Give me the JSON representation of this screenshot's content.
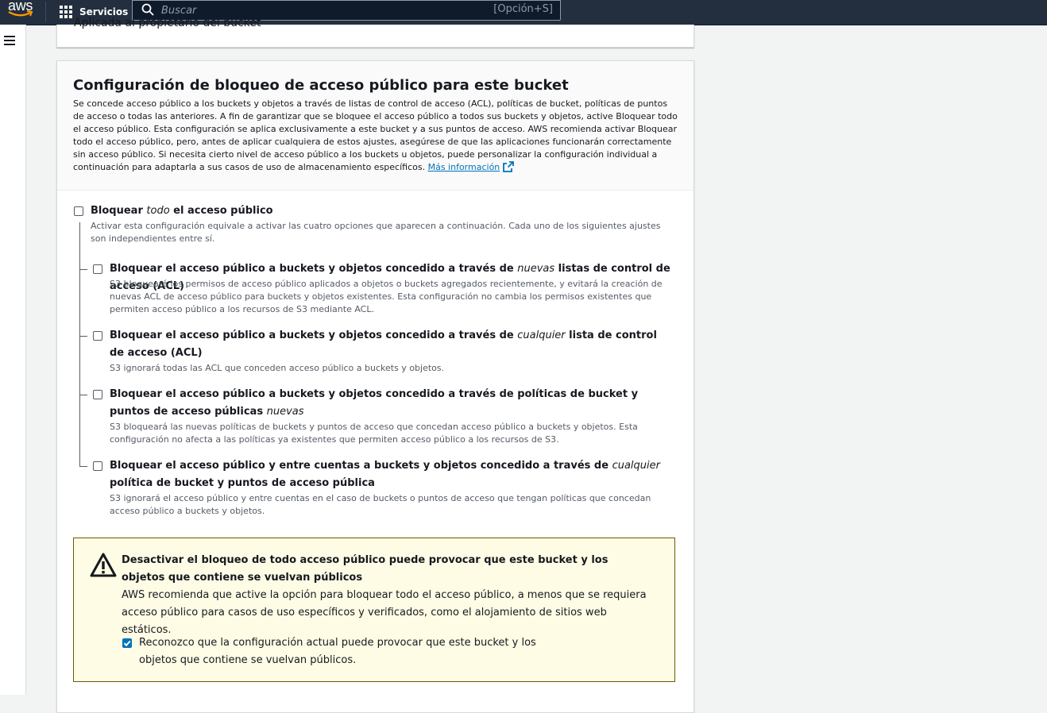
{
  "nav": {
    "logo": "aws",
    "services_label": "Servicios",
    "search_placeholder": "Buscar",
    "search_shortcut": "[Opción+S]"
  },
  "prev_panel": {
    "text": "Aplicada al propietario del bucket"
  },
  "block_public_access": {
    "title": "Configuración de bloqueo de acceso público para este bucket",
    "description": "Se concede acceso público a los buckets y objetos a través de listas de control de acceso (ACL), políticas de bucket, políticas de puntos de acceso o todas las anteriores. A fin de garantizar que se bloquee el acceso público a todos sus buckets y objetos, active Bloquear todo el acceso público. Esta configuración se aplica exclusivamente a este bucket y a sus puntos de acceso. AWS recomienda activar Bloquear todo el acceso público, pero, antes de aplicar cualquiera de estos ajustes, asegúrese de que las aplicaciones funcionarán correctamente sin acceso público. Si necesita cierto nivel de acceso público a los buckets u objetos, puede personalizar la configuración individual a continuación para adaptarla a sus casos de uso de almacenamiento específicos.",
    "learn_more": "Más información",
    "block_all": {
      "pre": "Bloquear ",
      "em": "todo",
      "post": " el acceso público",
      "desc": "Activar esta configuración equivale a activar las cuatro opciones que aparecen a continuación. Cada uno de los siguientes ajustes son independientes entre sí.",
      "checked": false
    },
    "options": [
      {
        "pre": "Bloquear el acceso público a buckets y objetos concedido a través de ",
        "em": "nuevas",
        "post": " listas de control de acceso (ACL)",
        "desc": "S3 bloqueará los permisos de acceso público aplicados a objetos o buckets agregados recientemente, y evitará la creación de nuevas ACL de acceso público para buckets y objetos existentes. Esta configuración no cambia los permisos existentes que permiten acceso público a los recursos de S3 mediante ACL.",
        "checked": false
      },
      {
        "pre": "Bloquear el acceso público a buckets y objetos concedido a través de ",
        "em": "cualquier",
        "post": " lista de control de acceso (ACL)",
        "desc": "S3 ignorará todas las ACL que conceden acceso público a buckets y objetos.",
        "checked": false
      },
      {
        "pre": "Bloquear el acceso público a buckets y objetos concedido a través de políticas de bucket y puntos de acceso públicas ",
        "em": "nuevas",
        "post": "",
        "desc": "S3 bloqueará las nuevas políticas de buckets y puntos de acceso que concedan acceso público a buckets y objetos. Esta configuración no afecta a las políticas ya existentes que permiten acceso público a los recursos de S3.",
        "checked": false
      },
      {
        "pre": "Bloquear el acceso público y entre cuentas a buckets y objetos concedido a través de ",
        "em": "cualquier",
        "post": " política de bucket y puntos de acceso pública",
        "desc": "S3 ignorará el acceso público y entre cuentas en el caso de buckets o puntos de acceso que tengan políticas que concedan acceso público a buckets y objetos.",
        "checked": false
      }
    ]
  },
  "warning": {
    "title": "Desactivar el bloqueo de todo acceso público puede provocar que este bucket y los objetos que contiene se vuelvan públicos",
    "body": "AWS recomienda que active la opción para bloquear todo el acceso público, a menos que se requiera acceso público para casos de uso específicos y verificados, como el alojamiento de sitios web estáticos.",
    "acknowledge": "Reconozco que la configuración actual puede provocar que este bucket y los objetos que contiene se vuelvan públicos.",
    "acknowledge_checked": true
  },
  "colors": {
    "nav_bg": "#232f3e",
    "link": "#0073bb",
    "checkbox_checked": "#0073bb",
    "warning_bg": "#fffce5",
    "warning_border": "#6a5c00",
    "aws_orange": "#ff9900"
  },
  "icons": {
    "services": "grid-icon",
    "search": "search-icon",
    "menu": "hamburger-icon",
    "external": "external-link-icon",
    "warning": "warning-triangle-icon",
    "check": "checkmark-icon"
  }
}
